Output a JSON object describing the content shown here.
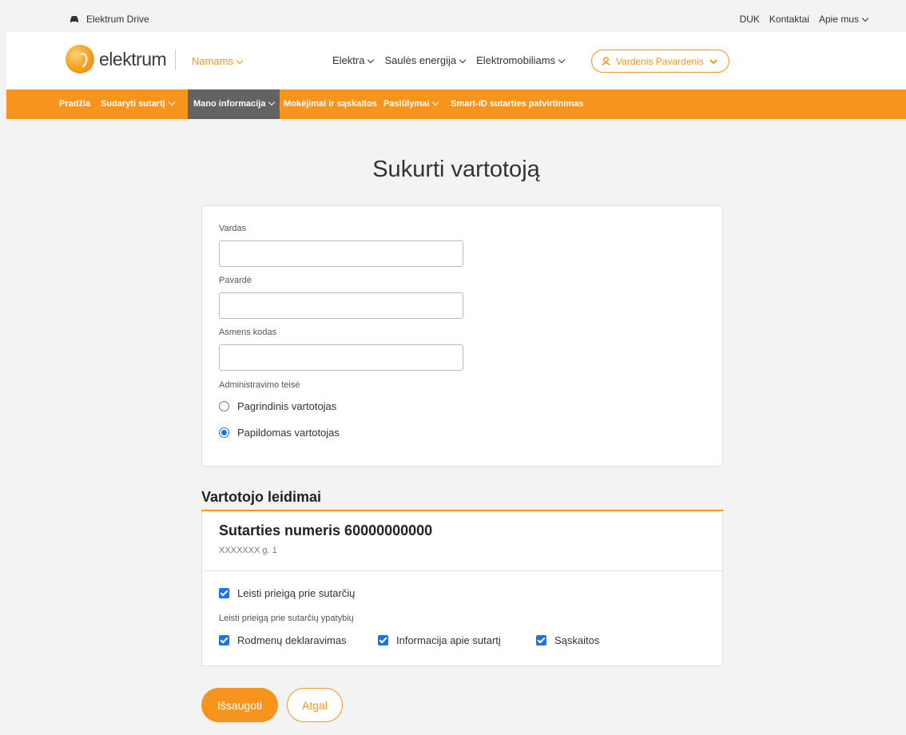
{
  "topbar": {
    "brand": "Elektrum Drive",
    "links": [
      "DUK",
      "Kontaktai",
      "Apie mus"
    ]
  },
  "header": {
    "logo_text": "elektrum",
    "segment": "Namams",
    "nav": [
      "Elektra",
      "Saulės energija",
      "Elektromobiliams"
    ],
    "user": "Vardenis Pavardenis"
  },
  "subnav": {
    "items": [
      "Pradžia",
      "Sudaryti sutartį",
      "Mano informacija",
      "Mokėjimai ir sąskaitos",
      "Pasiūlymai",
      "Smart-ID sutarties patvirtinimas"
    ],
    "active": "Mano informacija"
  },
  "page": {
    "title": "Sukurti vartotoją"
  },
  "form": {
    "first_name_label": "Vardas",
    "first_name_value": "",
    "last_name_label": "Pavardė",
    "last_name_value": "",
    "personal_code_label": "Asmens kodas",
    "personal_code_value": "",
    "admin_rights_label": "Administravimo teisė",
    "roles": [
      {
        "label": "Pagrindinis vartotojas",
        "selected": false
      },
      {
        "label": "Papildomas vartotojas",
        "selected": true
      }
    ]
  },
  "permissions": {
    "title": "Vartotojo leidimai",
    "contract_title": "Sutarties numeris 60000000000",
    "contract_address": "XXXXXXX g. 1",
    "allow_access_label": "Leisti prieigą prie sutarčių",
    "allow_access_checked": true,
    "features_label": "Leisti prieigą prie sutarčių ypatybių",
    "features": [
      {
        "label": "Rodmenų deklaravimas",
        "checked": true
      },
      {
        "label": "Informacija apie sutartį",
        "checked": true
      },
      {
        "label": "Sąskaitos",
        "checked": true
      }
    ]
  },
  "actions": {
    "save": "Išsaugoti",
    "back": "Atgal"
  },
  "colors": {
    "brand": "#f7941d",
    "active_tab": "#636363",
    "control": "#1a73e8"
  }
}
